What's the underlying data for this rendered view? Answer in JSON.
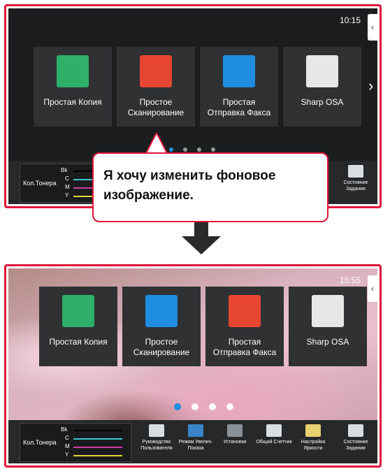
{
  "top": {
    "time": "10:15",
    "side_tab_icon": "chevron-left-icon",
    "tiles": [
      {
        "label": "Простая Копия",
        "icon": "copy-icon"
      },
      {
        "label": "Простое\nСканирование",
        "icon": "scan-icon"
      },
      {
        "label": "Простая\nОтправка Факса",
        "icon": "fax-icon"
      },
      {
        "label": "Sharp OSA",
        "icon": "osa-icon"
      }
    ],
    "next_arrow": "›",
    "toner": {
      "label": "Кол.Тонера",
      "bk": "Bk",
      "c": "C",
      "m": "M",
      "y": "Y"
    },
    "job_status": "Состояние\nЗадания"
  },
  "callout": {
    "text": "Я хочу изменить фоновое\nизображение."
  },
  "bottom": {
    "time": "15:55",
    "tiles": [
      {
        "label": "Простая Копия",
        "icon": "copy-icon"
      },
      {
        "label": "Простое\nСканирование",
        "icon": "fax-icon"
      },
      {
        "label": "Простая\nОтправка Факса",
        "icon": "scan-icon"
      },
      {
        "label": "Sharp OSA",
        "icon": "osa-icon"
      }
    ],
    "toner": {
      "label": "Кол.Тонера",
      "bk": "Bk",
      "c": "C",
      "m": "M",
      "y": "Y"
    },
    "bar_buttons": [
      {
        "label": "Руководство\nПользователя",
        "icon": "manual-icon"
      },
      {
        "label": "Режим Увелич.\nПоказа",
        "icon": "zoom-text-icon"
      },
      {
        "label": "Установки",
        "icon": "settings-tools-icon"
      },
      {
        "label": "Общий Счетчик",
        "icon": "counter-icon"
      },
      {
        "label": "Настройка\nЯркости",
        "icon": "brightness-icon"
      },
      {
        "label": "Состояние\nЗадания",
        "icon": "job-status-icon"
      }
    ]
  },
  "colors": {
    "frame": "#e0143c",
    "accent": "#1d8ee0"
  }
}
